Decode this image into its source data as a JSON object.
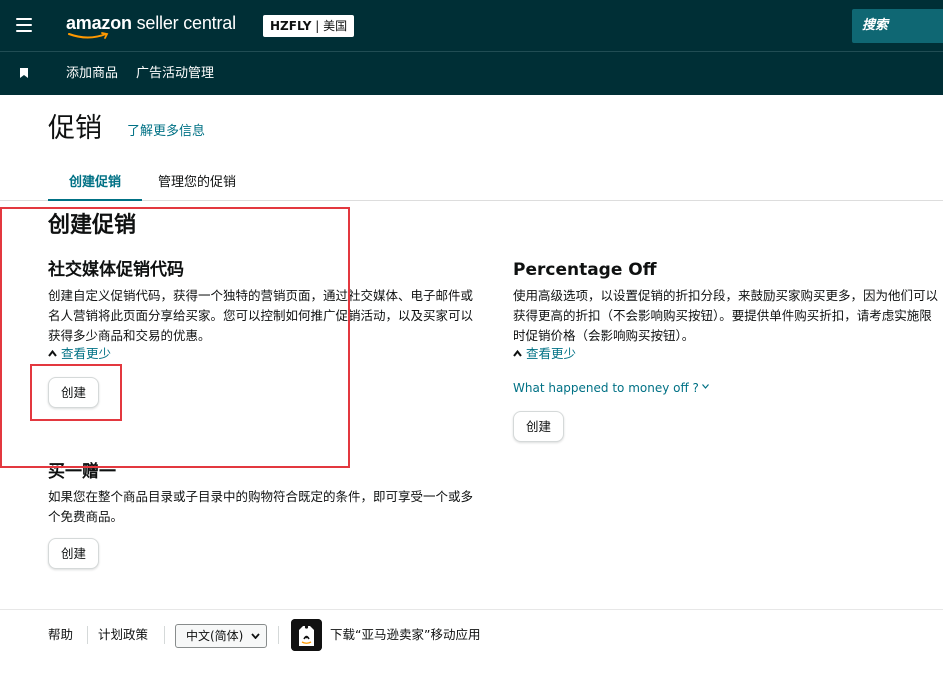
{
  "header": {
    "logo_text_main": "amazon",
    "logo_text_sub": " seller central",
    "store_name": "HZFLY",
    "store_region": "美国",
    "search_placeholder": "搜索"
  },
  "nav": {
    "items": [
      {
        "label": "添加商品"
      },
      {
        "label": "广告活动管理"
      }
    ]
  },
  "page": {
    "title": "促销",
    "learn_more": "了解更多信息"
  },
  "tabs": [
    {
      "label": "创建促销",
      "active": true
    },
    {
      "label": "管理您的促销",
      "active": false
    }
  ],
  "section": {
    "title": "创建促销"
  },
  "cards": {
    "social": {
      "title": "社交媒体促销代码",
      "description": "创建自定义促销代码，获得一个独特的营销页面，通过社交媒体、电子邮件或名人营销将此页面分享给买家。您可以控制如何推广促销活动，以及买家可以获得多少商品和交易的优惠。",
      "see_less": "查看更少",
      "button": "创建"
    },
    "percentage": {
      "title": "Percentage Off",
      "description": "使用高级选项，以设置促销的折扣分段，来鼓励买家购买更多，因为他们可以获得更高的折扣（不会影响购买按钮）。要提供单件购买折扣，请考虑实施限时促销价格（会影响购买按钮）。",
      "see_less": "查看更少",
      "money_link": "What happened to money off ?",
      "button": "创建"
    },
    "bogo": {
      "title": "买一赠一",
      "description": "如果您在整个商品目录或子目录中的购物符合既定的条件，即可享受一个或多个免费商品。",
      "button": "创建"
    }
  },
  "footer": {
    "help": "帮助",
    "policies": "计划政策",
    "language": "中文(简体)",
    "app_text": "下载“亚马逊卖家”移动应用"
  },
  "colors": {
    "header_bg": "#002f36",
    "search_bg": "#0f6773",
    "link": "#007185",
    "annotation": "#e3383f"
  },
  "icons": [
    "hamburger-menu-icon",
    "amazon-smile-icon",
    "bookmark-icon",
    "caret-up-icon",
    "chevron-down-icon",
    "amazon-app-icon"
  ]
}
